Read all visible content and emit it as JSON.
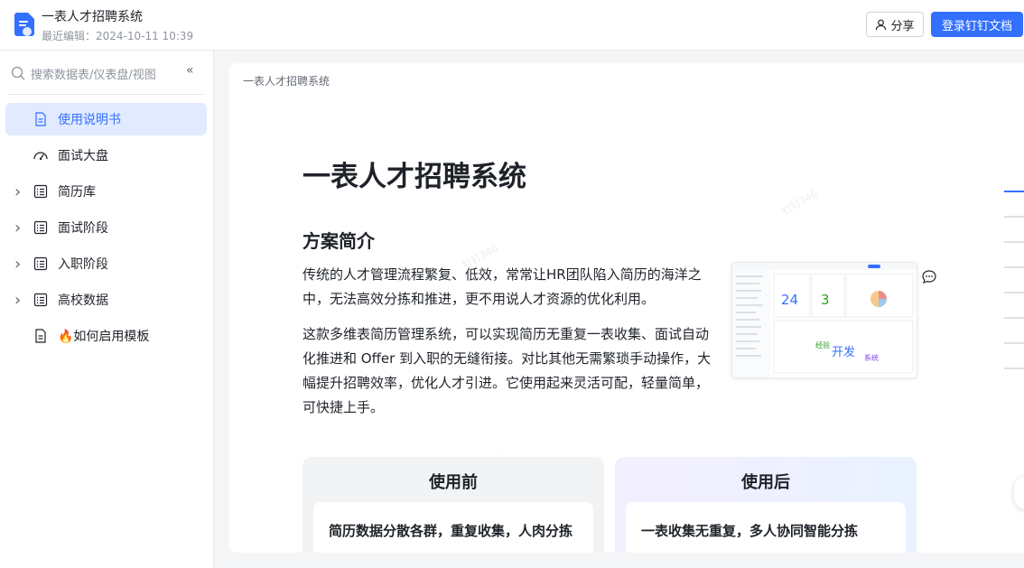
{
  "header": {
    "title": "一表人才招聘系统",
    "last_edited": "最近编辑：2024-10-11 10:39",
    "share_label": "分享",
    "login_label": "登录钉钉文档"
  },
  "sidebar": {
    "search_placeholder": "搜索数据表/仪表盘/视图",
    "collapse_glyph": "«",
    "items": [
      {
        "label": "使用说明书",
        "icon": "doc-icon",
        "expandable": false,
        "active": true
      },
      {
        "label": "面试大盘",
        "icon": "dashboard-icon",
        "expandable": false,
        "active": false
      },
      {
        "label": "简历库",
        "icon": "table-icon",
        "expandable": true,
        "active": false
      },
      {
        "label": "面试阶段",
        "icon": "table-icon",
        "expandable": true,
        "active": false
      },
      {
        "label": "入职阶段",
        "icon": "table-icon",
        "expandable": true,
        "active": false
      },
      {
        "label": "高校数据",
        "icon": "table-icon",
        "expandable": true,
        "active": false
      },
      {
        "label": "🔥如何启用模板",
        "icon": "doc-icon",
        "expandable": false,
        "active": false
      }
    ]
  },
  "content": {
    "breadcrumb": "一表人才招聘系统",
    "heading": "一表人才招聘系统",
    "section_title": "方案简介",
    "para1": "传统的人才管理流程繁复、低效，常常让HR团队陷入简历的海洋之中，无法高效分拣和推进，更不用说人才资源的优化利用。",
    "para2": "这款多维表简历管理系统，可以实现简历无重复一表收集、面试自动化推进和 Offer 到入职的无缝衔接。对比其他无需繁琐手动操作，大幅提升招聘效率，优化人才引进。它使用起来灵活可配，轻量简单，可快捷上手。",
    "before_title": "使用前",
    "before_text": "简历数据分散各群，重复收集，人肉分拣",
    "after_title": "使用后",
    "after_text": "一表收集无重复，多人协同智能分拣",
    "preview": {
      "stat1": "24",
      "stat2": "3",
      "word1": "开发",
      "word2": "经验",
      "word3": "系统"
    }
  },
  "colors": {
    "accent": "#3370ff",
    "active_bg": "#e1eaff"
  }
}
